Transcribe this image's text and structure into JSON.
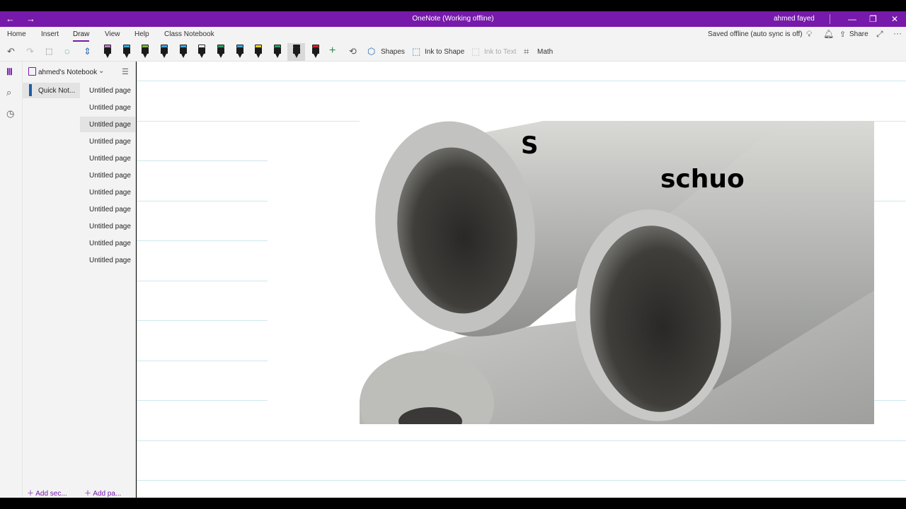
{
  "titlebar": {
    "back": "←",
    "forward": "→",
    "title": "OneNote (Working offline)",
    "user": "ahmed fayed",
    "minimize": "—",
    "restore": "❐",
    "close": "✕"
  },
  "menu": {
    "items": [
      "Home",
      "Insert",
      "Draw",
      "View",
      "Help",
      "Class Notebook"
    ],
    "active": "Draw",
    "status": "Saved offline (auto sync is off)",
    "share": "Share",
    "more": "···"
  },
  "toolbar": {
    "shapes": "Shapes",
    "ink_to_shape": "Ink to Shape",
    "ink_to_text": "Ink to Text",
    "math": "Math",
    "pens": [
      {
        "name": "pen-1",
        "color": "#c77bd0"
      },
      {
        "name": "pen-2",
        "color": "#3aa7e0"
      },
      {
        "name": "pen-3",
        "color": "#7dbb3d"
      },
      {
        "name": "pen-4",
        "color": "#3aa7e0"
      },
      {
        "name": "pen-5",
        "color": "#3aa7e0"
      },
      {
        "name": "pen-6",
        "color": "#ffffff"
      },
      {
        "name": "pen-7",
        "color": "#2e9e62"
      },
      {
        "name": "pen-8",
        "color": "#3aa7e0"
      },
      {
        "name": "pen-9",
        "color": "#f2d21a"
      },
      {
        "name": "pen-10",
        "color": "#2e9e62"
      },
      {
        "name": "pen-11",
        "color": "#1b1b1b"
      },
      {
        "name": "pen-12",
        "color": "#d81f26"
      }
    ]
  },
  "notebook": {
    "name": "ahmed's Notebook",
    "section": "Quick Not...",
    "pages": [
      "Untitled page",
      "Untitled page",
      "Untitled page",
      "Untitled page",
      "Untitled page",
      "Untitled page",
      "Untitled page",
      "Untitled page",
      "Untitled page",
      "Untitled page",
      "Untitled page"
    ],
    "selected_page_index": 2,
    "add_section": "Add sec...",
    "add_page": "Add pa..."
  },
  "ink": {
    "annotation_1": "S",
    "annotation_2": "schuo"
  },
  "colors": {
    "accent": "#7719aa",
    "section_tab": "#1f5ea8",
    "rule_line": "#cfe8ef"
  }
}
